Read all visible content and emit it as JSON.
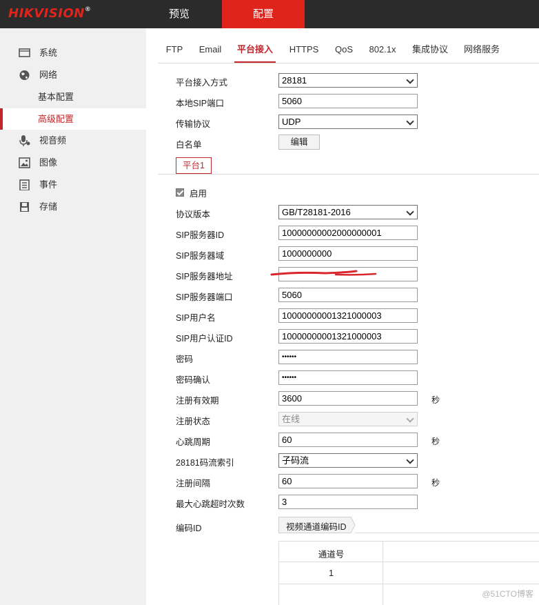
{
  "brand": {
    "logo_text": "HIKVISION",
    "logo_mark": "®"
  },
  "top_nav": {
    "preview": "预览",
    "config": "配置"
  },
  "sidebar": {
    "items": [
      {
        "label": "系统",
        "icon": "monitor-icon"
      },
      {
        "label": "网络",
        "icon": "globe-icon"
      },
      {
        "label": "基本配置"
      },
      {
        "label": "高级配置"
      },
      {
        "label": "视音频",
        "icon": "mic-icon"
      },
      {
        "label": "图像",
        "icon": "image-icon"
      },
      {
        "label": "事件",
        "icon": "list-icon"
      },
      {
        "label": "存储",
        "icon": "disk-icon"
      }
    ]
  },
  "tabs": [
    "FTP",
    "Email",
    "平台接入",
    "HTTPS",
    "QoS",
    "802.1x",
    "集成协议",
    "网络服务"
  ],
  "form_top": {
    "access_mode_label": "平台接入方式",
    "access_mode_value": "28181",
    "sip_port_label": "本地SIP端口",
    "sip_port_value": "5060",
    "transport_label": "传输协议",
    "transport_value": "UDP",
    "whitelist_label": "白名单",
    "edit_button": "编辑"
  },
  "platform_tab": "平台1",
  "enable_label": "启用",
  "fields": {
    "protocol_version": {
      "label": "协议版本",
      "value": "GB/T28181-2016"
    },
    "sip_server_id": {
      "label": "SIP服务器ID",
      "value": "10000000002000000001"
    },
    "sip_server_domain": {
      "label": "SIP服务器域",
      "value": "1000000000"
    },
    "sip_server_address": {
      "label": "SIP服务器地址",
      "value": ""
    },
    "sip_server_port": {
      "label": "SIP服务器端口",
      "value": "5060"
    },
    "sip_username": {
      "label": "SIP用户名",
      "value": "10000000001321000003"
    },
    "sip_auth_id": {
      "label": "SIP用户认证ID",
      "value": "10000000001321000003"
    },
    "password": {
      "label": "密码",
      "value": "••••••"
    },
    "password_confirm": {
      "label": "密码确认",
      "value": "••••••"
    },
    "reg_validity": {
      "label": "注册有效期",
      "value": "3600",
      "unit": "秒"
    },
    "reg_status": {
      "label": "注册状态",
      "value": "在线"
    },
    "heartbeat": {
      "label": "心跳周期",
      "value": "60",
      "unit": "秒"
    },
    "stream_index": {
      "label": "28181码流索引",
      "value": "子码流"
    },
    "reg_interval": {
      "label": "注册间隔",
      "value": "60",
      "unit": "秒"
    },
    "max_heartbeat_timeout": {
      "label": "最大心跳超时次数",
      "value": "3"
    }
  },
  "encode": {
    "label": "编码ID",
    "tab": "视频通道编码ID",
    "table_header": "通道号",
    "rows": [
      "1"
    ]
  },
  "watermark": "@51CTO博客",
  "colors": {
    "accent": "#c0272d",
    "topbar": "#2b2b2b",
    "brand_red": "#e0231b"
  }
}
